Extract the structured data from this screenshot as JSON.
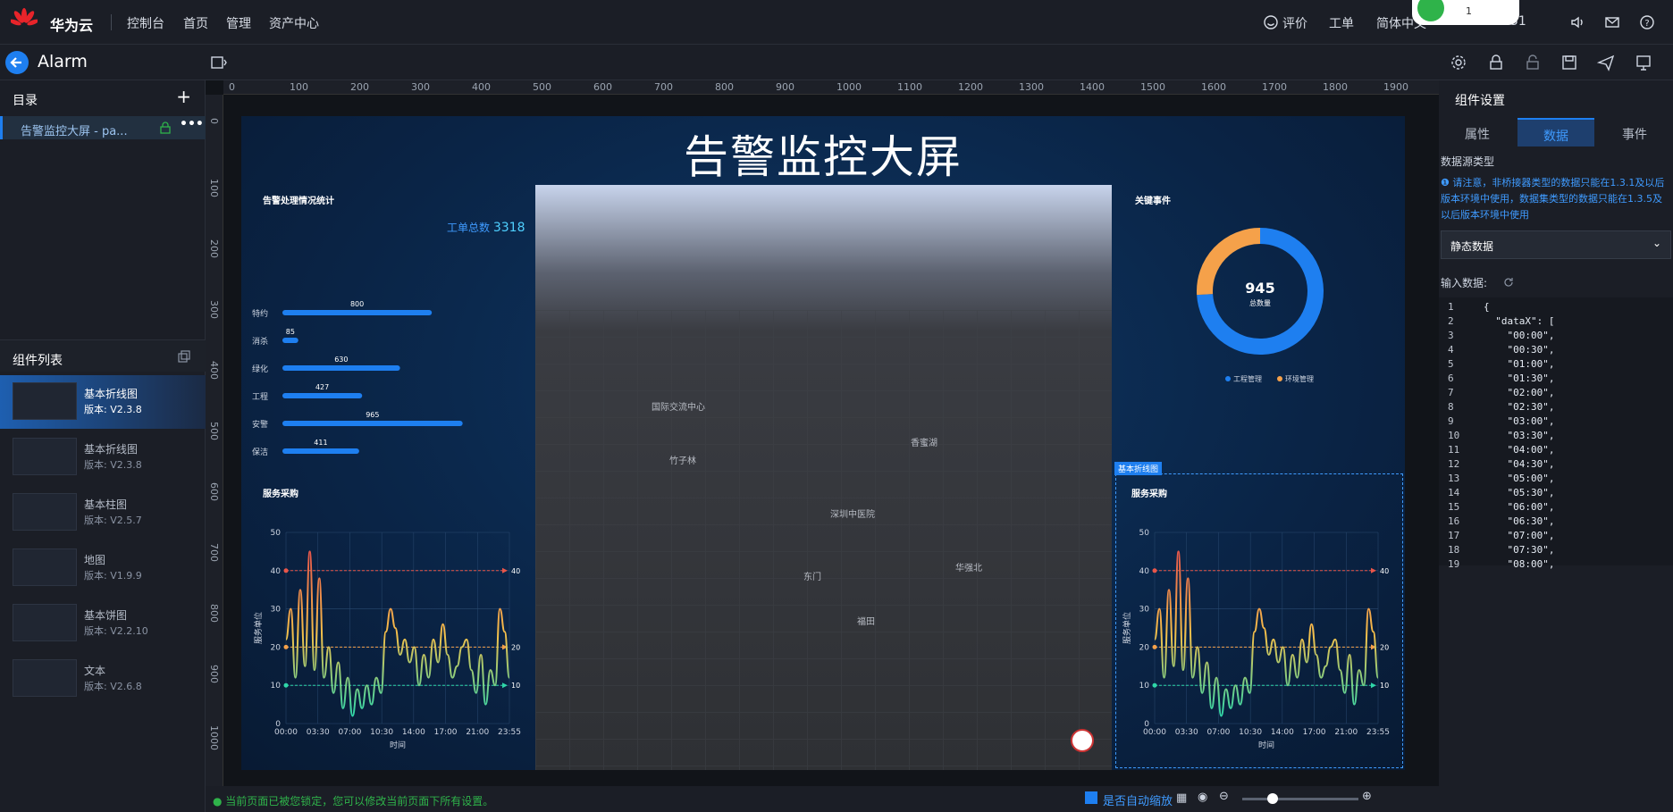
{
  "topbar": {
    "brand": "华为云",
    "nav": [
      "控制台",
      "首页",
      "管理",
      "资产中心"
    ],
    "right": [
      "评价",
      "工单",
      "简体中文",
      "51"
    ],
    "status_indicator": "1"
  },
  "toolbar": {
    "title": "Alarm"
  },
  "sidebar": {
    "directory_title": "目录",
    "directory_item": "告警监控大屏 - pa...",
    "components_title": "组件列表",
    "components": [
      {
        "name": "基本折线图",
        "version": "版本: V2.3.8"
      },
      {
        "name": "基本折线图",
        "version": "版本: V2.3.8"
      },
      {
        "name": "基本柱图",
        "version": "版本: V2.5.7"
      },
      {
        "name": "地图",
        "version": "版本: V1.9.9"
      },
      {
        "name": "基本饼图",
        "version": "版本: V2.2.10"
      },
      {
        "name": "文本",
        "version": "版本: V2.6.8"
      }
    ]
  },
  "ruler": {
    "h": [
      "0",
      "100",
      "200",
      "300",
      "400",
      "500",
      "600",
      "700",
      "800",
      "900",
      "1000",
      "1100",
      "1200",
      "1300",
      "1400",
      "1500",
      "1600",
      "1700",
      "1800",
      "1900"
    ],
    "v": [
      "0",
      "100",
      "200",
      "300",
      "400",
      "500",
      "600",
      "700",
      "800",
      "900",
      "1000"
    ]
  },
  "screen": {
    "title": "告警监控大屏",
    "left_top_title": "告警处理情况统计",
    "total_label": "工单总数",
    "total_value": "3318",
    "right_top_title": "关键事件",
    "left_bottom_title": "服务采购",
    "right_bottom_title": "服务采购",
    "selected_label": "基本折线图"
  },
  "map_labels": [
    "东门",
    "华强北",
    "深圳中医院",
    "香蜜湖",
    "福田",
    "国际交流中心",
    "竹子林"
  ],
  "chart_data": [
    {
      "type": "bar",
      "orientation": "horizontal",
      "title": "告警处理情况统计",
      "categories": [
        "特约",
        "消杀",
        "绿化",
        "工程",
        "安警",
        "保洁"
      ],
      "series": [
        {
          "name": "工单总数",
          "values": [
            800,
            85,
            630,
            427,
            965,
            411
          ]
        }
      ],
      "xlim": [
        0,
        1000
      ],
      "xticks": [
        "0",
        "500",
        "1,000"
      ],
      "color": "#1e7ff0"
    },
    {
      "type": "pie",
      "title": "关键事件",
      "center_value": "945",
      "center_label": "总数量",
      "series": [
        {
          "name": "工程管理",
          "value": 700,
          "color": "#1e7ff0"
        },
        {
          "name": "环境管理",
          "value": 245,
          "color": "#f5a14a"
        }
      ],
      "legend": "bottom"
    },
    {
      "type": "line",
      "title": "服务采购",
      "xlabel": "时间",
      "ylabel": "服务单位",
      "ylim": [
        0,
        50
      ],
      "yticks": [
        "0",
        "10",
        "20",
        "30",
        "40",
        "50"
      ],
      "xticks": [
        "00:00",
        "03:30",
        "07:00",
        "10:30",
        "14:00",
        "17:00",
        "21:00",
        "23:55"
      ],
      "x": [
        0,
        1,
        2,
        3,
        4,
        5,
        6,
        7,
        8,
        9,
        10,
        11,
        12,
        13,
        14,
        15,
        16,
        17,
        18,
        19,
        20,
        21,
        22,
        23,
        24,
        25,
        26,
        27,
        28,
        29,
        30,
        31,
        32,
        33,
        34,
        35,
        36,
        37,
        38,
        39,
        40,
        41,
        42,
        43,
        44,
        45,
        46,
        47
      ],
      "values": [
        22,
        30,
        12,
        35,
        15,
        45,
        14,
        38,
        12,
        20,
        8,
        16,
        4,
        12,
        2,
        9,
        4,
        10,
        5,
        12,
        8,
        24,
        30,
        25,
        18,
        22,
        16,
        20,
        10,
        18,
        12,
        22,
        16,
        26,
        18,
        12,
        15,
        20,
        22,
        14,
        8,
        18,
        5,
        14,
        10,
        30,
        24,
        12
      ],
      "marklines": [
        {
          "value": 40,
          "color": "#e8564a"
        },
        {
          "value": 20,
          "color": "#f5a14a"
        },
        {
          "value": 10,
          "color": "#2fd6a8"
        }
      ]
    },
    {
      "type": "line",
      "title": "服务采购",
      "xlabel": "时间",
      "ylabel": "服务单位",
      "ylim": [
        0,
        50
      ],
      "yticks": [
        "0",
        "10",
        "20",
        "30",
        "40",
        "50"
      ],
      "xticks": [
        "00:00",
        "03:30",
        "07:00",
        "10:30",
        "14:00",
        "17:00",
        "21:00",
        "23:55"
      ],
      "x": [
        0,
        1,
        2,
        3,
        4,
        5,
        6,
        7,
        8,
        9,
        10,
        11,
        12,
        13,
        14,
        15,
        16,
        17,
        18,
        19,
        20,
        21,
        22,
        23,
        24,
        25,
        26,
        27,
        28,
        29,
        30,
        31,
        32,
        33,
        34,
        35,
        36,
        37,
        38,
        39,
        40,
        41,
        42,
        43,
        44,
        45,
        46,
        47
      ],
      "values": [
        22,
        30,
        12,
        35,
        15,
        45,
        14,
        38,
        12,
        20,
        8,
        16,
        4,
        12,
        2,
        9,
        4,
        10,
        5,
        12,
        8,
        24,
        30,
        25,
        18,
        22,
        16,
        20,
        10,
        18,
        12,
        22,
        16,
        26,
        18,
        12,
        15,
        20,
        22,
        14,
        8,
        18,
        5,
        14,
        10,
        30,
        24,
        12
      ],
      "marklines": [
        {
          "value": 40,
          "color": "#e8564a"
        },
        {
          "value": 20,
          "color": "#f5a14a"
        },
        {
          "value": 10,
          "color": "#2fd6a8"
        }
      ]
    }
  ],
  "props": {
    "title": "组件设置",
    "tabs": [
      "属性",
      "数据",
      "事件"
    ],
    "source_label": "数据源类型",
    "notice": "请注意，非桥接器类型的数据只能在1.3.1及以后版本环境中使用，数据集类型的数据只能在1.3.5及以后版本环境中使用",
    "source_value": "静态数据",
    "input_label": "输入数据:",
    "code_lines": [
      "{",
      "  \"dataX\": [",
      "    \"00:00\",",
      "    \"00:30\",",
      "    \"01:00\",",
      "    \"01:30\",",
      "    \"02:00\",",
      "    \"02:30\",",
      "    \"03:00\",",
      "    \"03:30\",",
      "    \"04:00\",",
      "    \"04:30\",",
      "    \"05:00\",",
      "    \"05:30\",",
      "    \"06:00\",",
      "    \"06:30\",",
      "    \"07:00\",",
      "    \"07:30\",",
      "    \"08:00\","
    ]
  },
  "statusbar": {
    "note": "当前页面已被您锁定，您可以修改当前页面下所有设置。",
    "auto_zoom": "是否自动缩放"
  }
}
